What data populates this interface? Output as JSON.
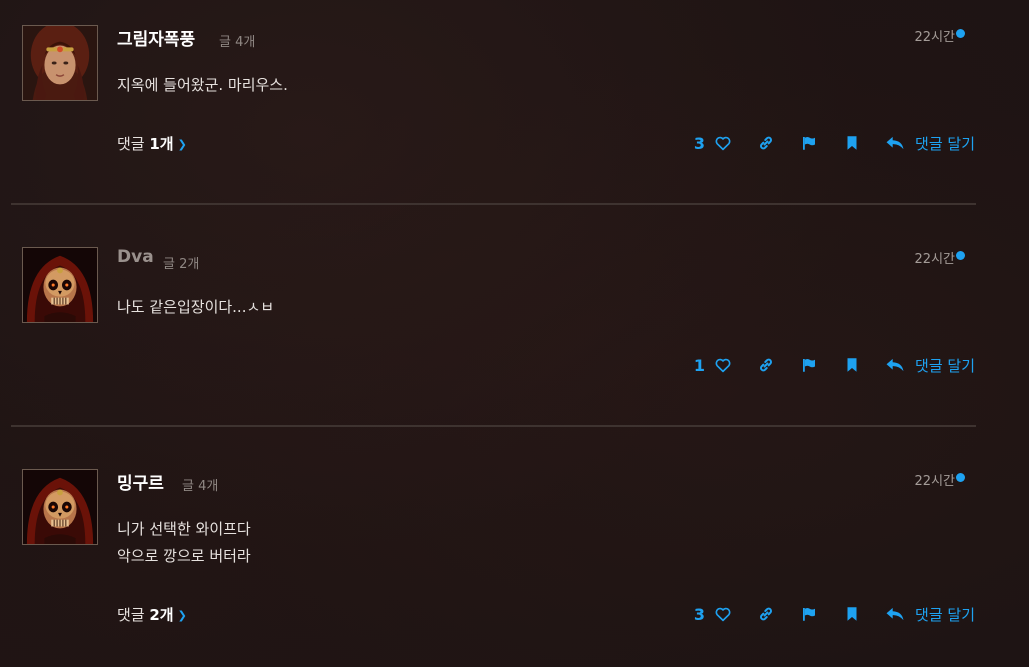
{
  "theme": {
    "accent": "#1ea2f1",
    "background": "#1d1414",
    "divider": "#3e3330"
  },
  "posts": [
    {
      "username": "그림자폭풍",
      "post_count": "글 4개",
      "time": "22시간",
      "avatar": "sorceress-portrait",
      "lines": [
        "지옥에 들어왔군. 마리우스."
      ],
      "replies": {
        "prefix": "댓글 ",
        "count": "1개",
        "visible": true
      },
      "likes": "3",
      "reply_label": "댓글 달기"
    },
    {
      "username": "Dva",
      "post_count": "글 2개",
      "time": "22시간",
      "avatar": "skull-portrait",
      "lines": [
        "나도 같은입장이다...ㅅㅂ"
      ],
      "replies": {
        "prefix": "",
        "count": "",
        "visible": false
      },
      "likes": "1",
      "reply_label": "댓글 달기"
    },
    {
      "username": "밍구르",
      "post_count": "글 4개",
      "time": "22시간",
      "avatar": "skull-portrait",
      "lines": [
        "니가 선택한 와이프다",
        "악으로 깡으로 버터라"
      ],
      "replies": {
        "prefix": "댓글 ",
        "count": "2개",
        "visible": true
      },
      "likes": "3",
      "reply_label": "댓글 달기"
    }
  ]
}
